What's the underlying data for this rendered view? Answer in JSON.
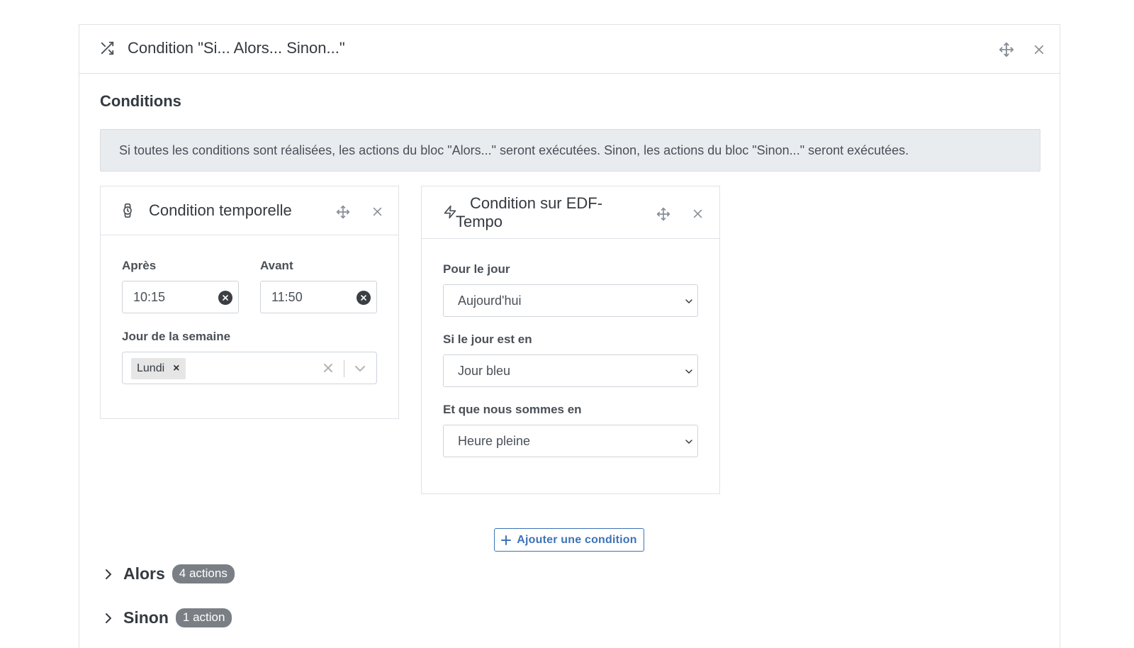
{
  "header": {
    "title": "Condition \"Si... Alors... Sinon...\"",
    "icon": "shuffle-icon"
  },
  "conditions_section": {
    "title": "Conditions",
    "info": "Si toutes les conditions sont réalisées, les actions du bloc \"Alors...\" seront exécutées. Sinon, les actions du bloc \"Sinon...\" seront exécutées."
  },
  "time_condition": {
    "title": "Condition temporelle",
    "icon": "watch-icon",
    "after_label": "Après",
    "after_value": "10:15",
    "before_label": "Avant",
    "before_value": "11:50",
    "weekday_label": "Jour de la semaine",
    "weekday_tags": [
      "Lundi"
    ]
  },
  "edf_condition": {
    "title_line1": "Condition sur EDF-",
    "title_line2": "Tempo",
    "icon": "lightning-icon",
    "day_label": "Pour le jour",
    "day_value": "Aujourd'hui",
    "color_label": "Si le jour est en",
    "color_value": "Jour bleu",
    "period_label": "Et que nous sommes en",
    "period_value": "Heure pleine"
  },
  "add_condition_label": "Ajouter une condition",
  "then_block": {
    "title": "Alors",
    "badge": "4 actions"
  },
  "else_block": {
    "title": "Sinon",
    "badge": "1 action"
  },
  "colors": {
    "primary": "#3d73b8",
    "badge": "#7a7f85",
    "info_bg": "#e9ecef"
  }
}
